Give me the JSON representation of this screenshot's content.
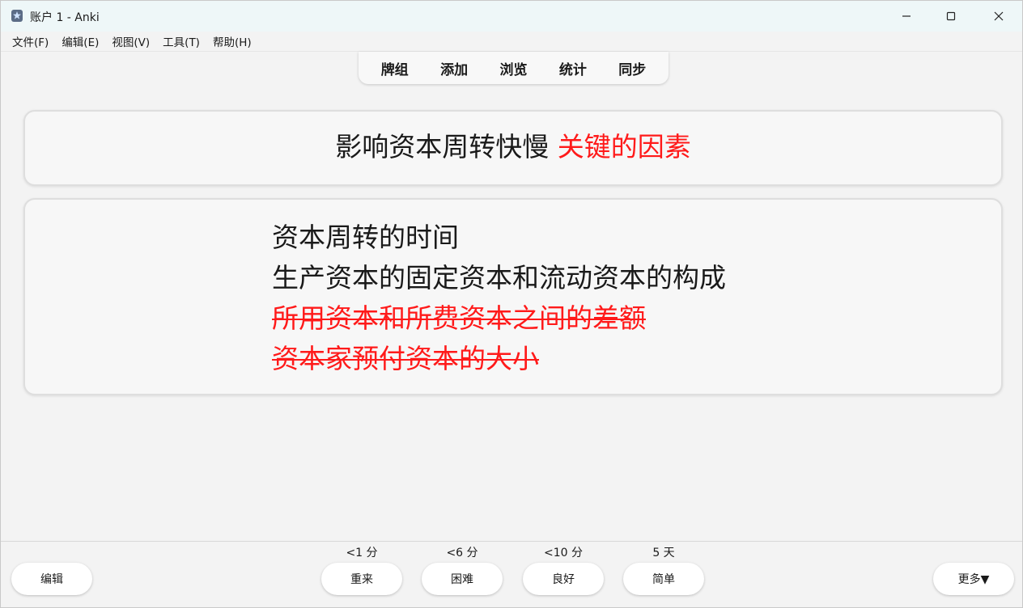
{
  "window": {
    "title": "账户 1 - Anki"
  },
  "menu": {
    "items": [
      "文件(F)",
      "编辑(E)",
      "视图(V)",
      "工具(T)",
      "帮助(H)"
    ]
  },
  "toolbar": {
    "tabs": [
      "牌组",
      "添加",
      "浏览",
      "统计",
      "同步"
    ]
  },
  "card": {
    "question_main": "影响资本周转快慢",
    "question_highlight": "关键的因素",
    "answers": [
      {
        "text": "资本周转的时间",
        "struck": false
      },
      {
        "text": "生产资本的固定资本和流动资本的构成",
        "struck": false
      },
      {
        "text": "所用资本和所费资本之间的差额",
        "struck": true
      },
      {
        "text": "资本家预付资本的大小",
        "struck": true
      }
    ]
  },
  "bottom": {
    "edit_label": "编辑",
    "more_label": "更多▼",
    "ease": [
      {
        "label": "重来",
        "interval": "<1 分"
      },
      {
        "label": "困难",
        "interval": "<6 分"
      },
      {
        "label": "良好",
        "interval": "<10 分"
      },
      {
        "label": "简单",
        "interval": "5 天"
      }
    ]
  },
  "colors": {
    "highlight": "#ff1a1a",
    "titlebar": "#eef7f8"
  },
  "icons": {
    "app": "anki-star-icon",
    "minimize": "minimize-icon",
    "maximize": "maximize-icon",
    "close": "close-icon"
  }
}
